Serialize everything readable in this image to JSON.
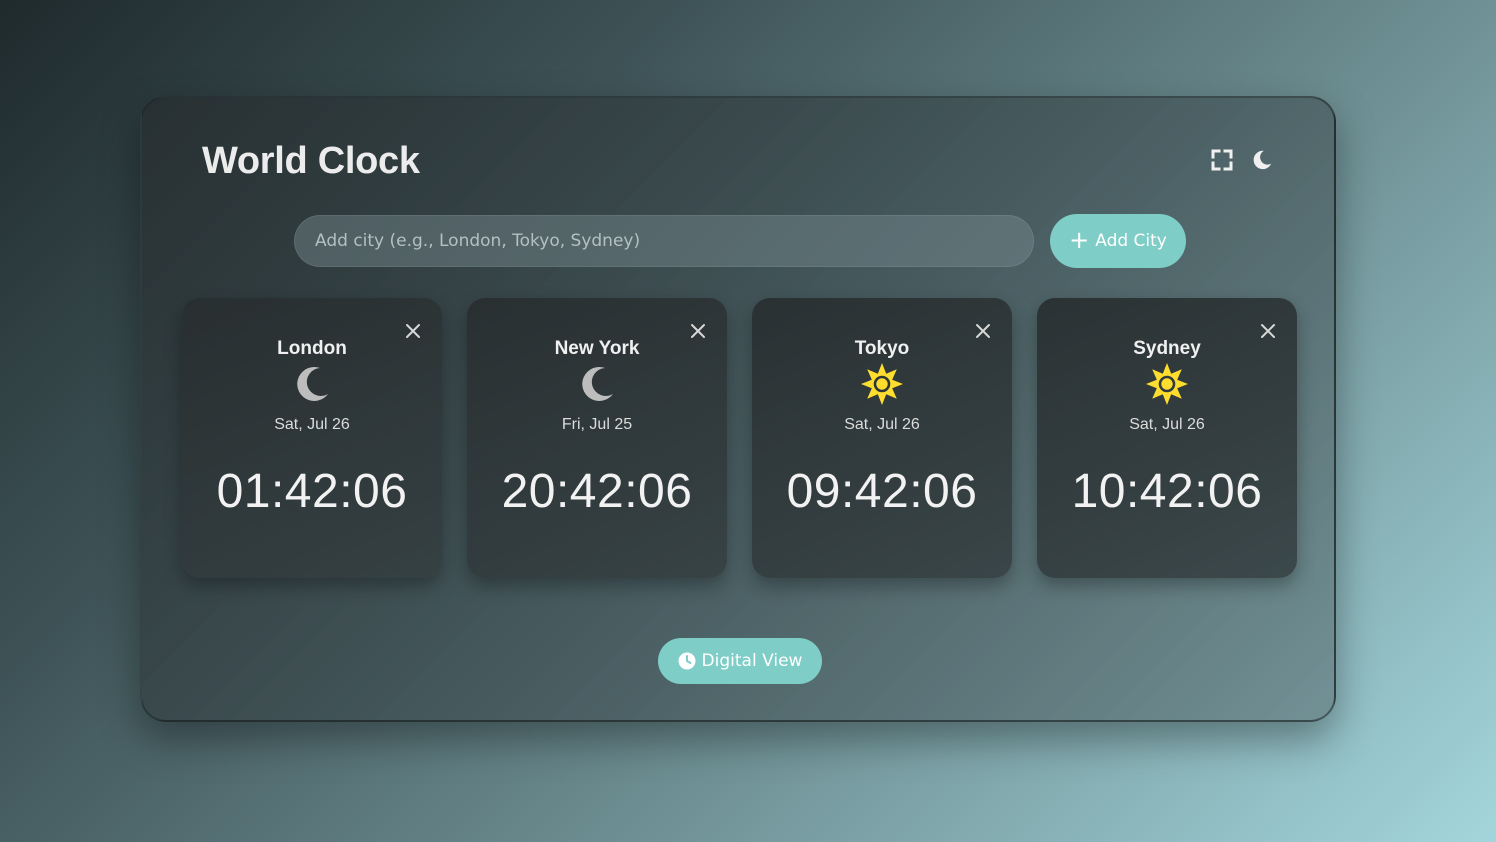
{
  "app": {
    "title": "World Clock"
  },
  "header": {
    "fullscreen_icon": "fullscreen-icon",
    "theme_icon": "moon-icon"
  },
  "search": {
    "placeholder": "Add city (e.g., London, Tokyo, Sydney)",
    "value": "",
    "add_label": "Add City"
  },
  "cities": [
    {
      "name": "London",
      "icon": "moon-icon",
      "date": "Sat, Jul 26",
      "time": "01:42:06"
    },
    {
      "name": "New York",
      "icon": "moon-icon",
      "date": "Fri, Jul 25",
      "time": "20:42:06"
    },
    {
      "name": "Tokyo",
      "icon": "sun-icon",
      "date": "Sat, Jul 26",
      "time": "09:42:06"
    },
    {
      "name": "Sydney",
      "icon": "sun-icon",
      "date": "Sat, Jul 26",
      "time": "10:42:06"
    }
  ],
  "footer": {
    "view_label": "Digital View"
  },
  "colors": {
    "accent": "#7ecdc6",
    "sun": "#fddd2e",
    "moon": "#bdbdbd"
  }
}
